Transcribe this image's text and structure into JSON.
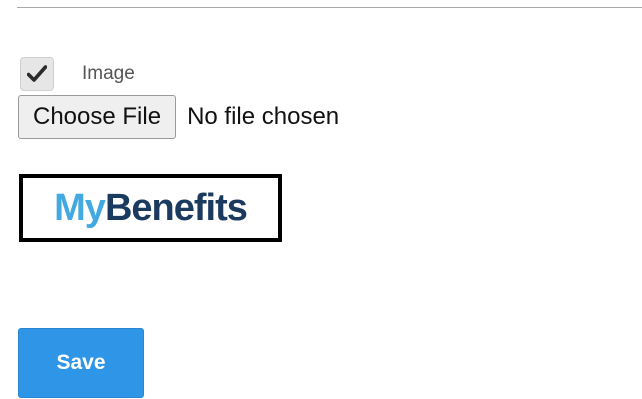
{
  "form": {
    "image_checkbox": {
      "label": "Image",
      "checked": true,
      "icon": "checkmark-icon"
    },
    "file_input": {
      "button_label": "Choose File",
      "status_text": "No file chosen"
    },
    "logo": {
      "text_part1": "My",
      "text_part2": "Benefits",
      "colors": {
        "my": "#42a9e1",
        "benefits": "#1b3a5f"
      }
    },
    "save_label": "Save"
  },
  "colors": {
    "accent": "#2f95e6"
  }
}
